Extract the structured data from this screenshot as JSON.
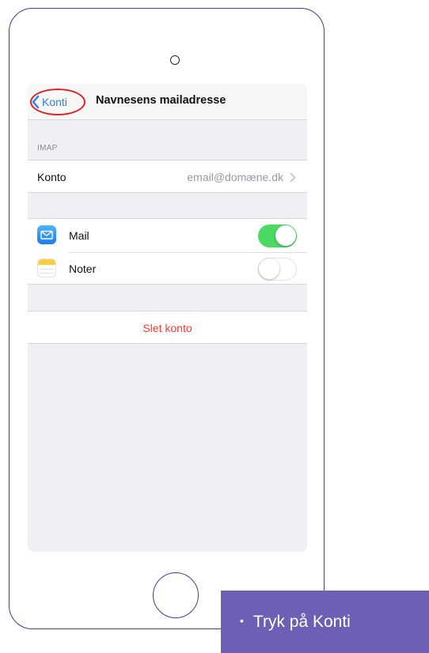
{
  "nav": {
    "back_label": "Konti",
    "title": "Navnesens mailadresse"
  },
  "account_section": {
    "header": "IMAP",
    "row_label": "Konto",
    "row_value": "email@domæne.dk"
  },
  "apps": [
    {
      "label": "Mail",
      "icon": "mail-icon",
      "enabled": true
    },
    {
      "label": "Noter",
      "icon": "notes-icon",
      "enabled": false
    }
  ],
  "delete_label": "Slet konto",
  "instruction": {
    "bullet": "•",
    "text": "Tryk på Konti"
  },
  "colors": {
    "accent_blue": "#2f7ef6",
    "highlight_red": "#e02323",
    "toggle_on": "#4cd964",
    "delete_red": "#ff3b30",
    "instruction_bg": "#6e5fb6",
    "phone_outline": "#3d3d9c"
  }
}
